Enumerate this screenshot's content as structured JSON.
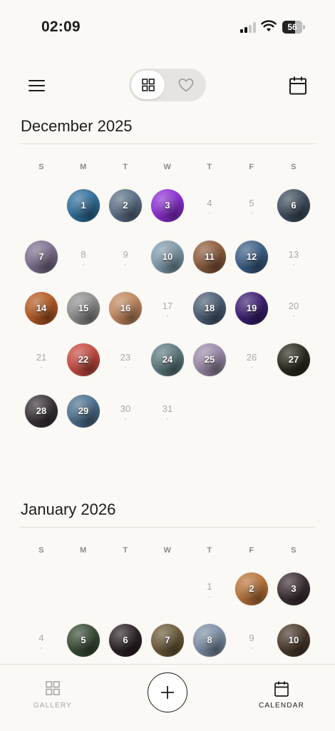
{
  "status_bar": {
    "time": "02:09",
    "battery": "56"
  },
  "header": {
    "menu_icon": "hamburger-menu-icon",
    "view_toggle": {
      "selected": "grid",
      "grid_icon": "grid-icon",
      "favorites_icon": "heart-icon"
    },
    "calendar_icon": "calendar-icon"
  },
  "weekdays": [
    "S",
    "M",
    "T",
    "W",
    "T",
    "F",
    "S"
  ],
  "months": [
    {
      "title": "December 2025",
      "days": [
        {
          "n": "1",
          "photo": true,
          "color": "#2f6e9a"
        },
        {
          "n": "2",
          "photo": true,
          "color": "#5b6f86"
        },
        {
          "n": "3",
          "photo": true,
          "color": "#8b2fd1"
        },
        {
          "n": "4",
          "photo": false
        },
        {
          "n": "5",
          "photo": false
        },
        {
          "n": "6",
          "photo": true,
          "color": "#3f4d5e"
        },
        {
          "n": "7",
          "photo": true,
          "color": "#7d6f8e"
        },
        {
          "n": "8",
          "photo": false
        },
        {
          "n": "9",
          "photo": false
        },
        {
          "n": "10",
          "photo": true,
          "color": "#7f9aab"
        },
        {
          "n": "11",
          "photo": true,
          "color": "#8c5c3c"
        },
        {
          "n": "12",
          "photo": true,
          "color": "#3a5f86"
        },
        {
          "n": "13",
          "photo": false
        },
        {
          "n": "14",
          "photo": true,
          "color": "#b35a22"
        },
        {
          "n": "15",
          "photo": true,
          "color": "#8e8e8e"
        },
        {
          "n": "16",
          "photo": true,
          "color": "#c0875e"
        },
        {
          "n": "17",
          "photo": false
        },
        {
          "n": "18",
          "photo": true,
          "color": "#4a5e74"
        },
        {
          "n": "19",
          "photo": true,
          "color": "#3c1e72"
        },
        {
          "n": "20",
          "photo": false
        },
        {
          "n": "21",
          "photo": false
        },
        {
          "n": "22",
          "photo": true,
          "color": "#c44a40"
        },
        {
          "n": "23",
          "photo": false
        },
        {
          "n": "24",
          "photo": true,
          "color": "#5d7a7e"
        },
        {
          "n": "25",
          "photo": true,
          "color": "#9a8aa8"
        },
        {
          "n": "26",
          "photo": false
        },
        {
          "n": "27",
          "photo": true,
          "color": "#2b2a1e"
        },
        {
          "n": "28",
          "photo": true,
          "color": "#3a3338"
        },
        {
          "n": "29",
          "photo": true,
          "color": "#4d6f8e"
        },
        {
          "n": "30",
          "photo": false
        },
        {
          "n": "31",
          "photo": false
        }
      ]
    },
    {
      "title": "January 2026",
      "days": [
        {
          "n": "1",
          "photo": false
        },
        {
          "n": "2",
          "photo": true,
          "color": "#b8733a"
        },
        {
          "n": "3",
          "photo": true,
          "color": "#3b2e33"
        },
        {
          "n": "4",
          "photo": false
        },
        {
          "n": "5",
          "photo": true,
          "color": "#3a4c36"
        },
        {
          "n": "6",
          "photo": true,
          "color": "#2c2226"
        },
        {
          "n": "7",
          "photo": true,
          "color": "#6b5a3a"
        },
        {
          "n": "8",
          "photo": true,
          "color": "#7d8fa6"
        },
        {
          "n": "9",
          "photo": false
        },
        {
          "n": "10",
          "photo": true,
          "color": "#4a3a2c"
        }
      ]
    }
  ],
  "bottom_nav": {
    "gallery_label": "GALLERY",
    "calendar_label": "CALENDAR",
    "active": "calendar",
    "gallery_icon": "grid-icon",
    "add_icon": "plus-icon",
    "calendar_icon": "calendar-icon"
  }
}
